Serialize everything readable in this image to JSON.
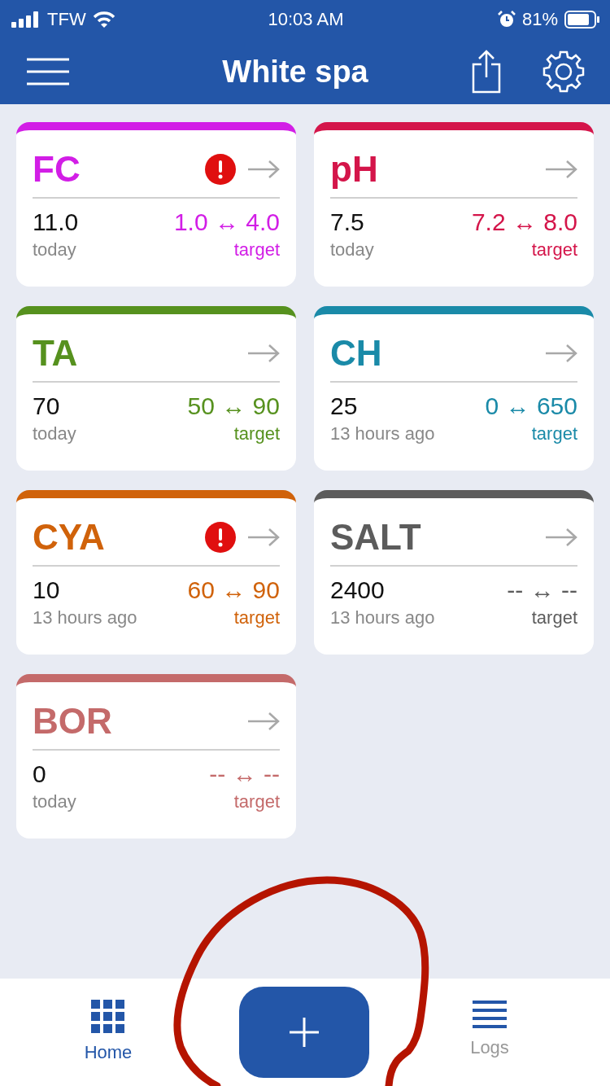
{
  "status_bar": {
    "carrier": "TFW",
    "time": "10:03 AM",
    "battery": "81%"
  },
  "header": {
    "title": "White spa"
  },
  "tests": [
    {
      "name": "FC",
      "color": "#d21ee6",
      "alert": true,
      "value": "11.0",
      "when": "today",
      "range": "1.0 ↔ 4.0",
      "target": "target"
    },
    {
      "name": "pH",
      "color": "#d4154a",
      "alert": false,
      "value": "7.5",
      "when": "today",
      "range": "7.2 ↔ 8.0",
      "target": "target"
    },
    {
      "name": "TA",
      "color": "#56911e",
      "alert": false,
      "value": "70",
      "when": "today",
      "range": "50 ↔ 90",
      "target": "target"
    },
    {
      "name": "CH",
      "color": "#1a8aa8",
      "alert": false,
      "value": "25",
      "when": "13 hours ago",
      "range": "0 ↔ 650",
      "target": "target"
    },
    {
      "name": "CYA",
      "color": "#d0620a",
      "alert": true,
      "value": "10",
      "when": "13 hours ago",
      "range": "60 ↔ 90",
      "target": "target"
    },
    {
      "name": "SALT",
      "color": "#5c5c5c",
      "alert": false,
      "value": "2400",
      "when": "13 hours ago",
      "range": "-- ↔ --",
      "target": "target"
    },
    {
      "name": "BOR",
      "color": "#c46a6a",
      "alert": false,
      "value": "0",
      "when": "today",
      "range": "-- ↔ --",
      "target": "target"
    }
  ],
  "tabs": [
    {
      "label": "Home",
      "kind": "grid",
      "selected": true
    },
    {
      "label": "Logs",
      "kind": "list",
      "selected": false
    }
  ],
  "annotation": {
    "color": "#b51400"
  }
}
